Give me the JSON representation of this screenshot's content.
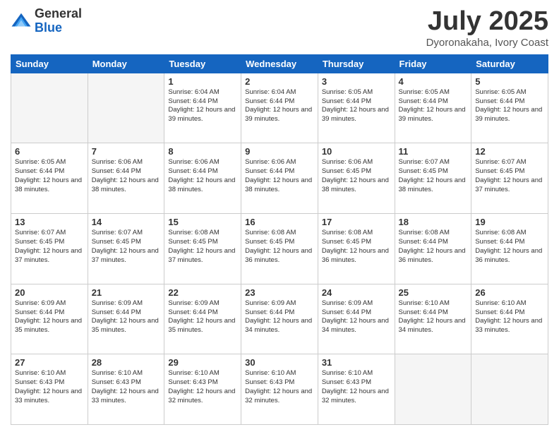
{
  "header": {
    "logo_general": "General",
    "logo_blue": "Blue",
    "title": "July 2025",
    "subtitle": "Dyoronakaha, Ivory Coast"
  },
  "calendar": {
    "days_of_week": [
      "Sunday",
      "Monday",
      "Tuesday",
      "Wednesday",
      "Thursday",
      "Friday",
      "Saturday"
    ],
    "weeks": [
      [
        {
          "day": "",
          "info": ""
        },
        {
          "day": "",
          "info": ""
        },
        {
          "day": "1",
          "info": "Sunrise: 6:04 AM\nSunset: 6:44 PM\nDaylight: 12 hours and 39 minutes."
        },
        {
          "day": "2",
          "info": "Sunrise: 6:04 AM\nSunset: 6:44 PM\nDaylight: 12 hours and 39 minutes."
        },
        {
          "day": "3",
          "info": "Sunrise: 6:05 AM\nSunset: 6:44 PM\nDaylight: 12 hours and 39 minutes."
        },
        {
          "day": "4",
          "info": "Sunrise: 6:05 AM\nSunset: 6:44 PM\nDaylight: 12 hours and 39 minutes."
        },
        {
          "day": "5",
          "info": "Sunrise: 6:05 AM\nSunset: 6:44 PM\nDaylight: 12 hours and 39 minutes."
        }
      ],
      [
        {
          "day": "6",
          "info": "Sunrise: 6:05 AM\nSunset: 6:44 PM\nDaylight: 12 hours and 38 minutes."
        },
        {
          "day": "7",
          "info": "Sunrise: 6:06 AM\nSunset: 6:44 PM\nDaylight: 12 hours and 38 minutes."
        },
        {
          "day": "8",
          "info": "Sunrise: 6:06 AM\nSunset: 6:44 PM\nDaylight: 12 hours and 38 minutes."
        },
        {
          "day": "9",
          "info": "Sunrise: 6:06 AM\nSunset: 6:44 PM\nDaylight: 12 hours and 38 minutes."
        },
        {
          "day": "10",
          "info": "Sunrise: 6:06 AM\nSunset: 6:45 PM\nDaylight: 12 hours and 38 minutes."
        },
        {
          "day": "11",
          "info": "Sunrise: 6:07 AM\nSunset: 6:45 PM\nDaylight: 12 hours and 38 minutes."
        },
        {
          "day": "12",
          "info": "Sunrise: 6:07 AM\nSunset: 6:45 PM\nDaylight: 12 hours and 37 minutes."
        }
      ],
      [
        {
          "day": "13",
          "info": "Sunrise: 6:07 AM\nSunset: 6:45 PM\nDaylight: 12 hours and 37 minutes."
        },
        {
          "day": "14",
          "info": "Sunrise: 6:07 AM\nSunset: 6:45 PM\nDaylight: 12 hours and 37 minutes."
        },
        {
          "day": "15",
          "info": "Sunrise: 6:08 AM\nSunset: 6:45 PM\nDaylight: 12 hours and 37 minutes."
        },
        {
          "day": "16",
          "info": "Sunrise: 6:08 AM\nSunset: 6:45 PM\nDaylight: 12 hours and 36 minutes."
        },
        {
          "day": "17",
          "info": "Sunrise: 6:08 AM\nSunset: 6:45 PM\nDaylight: 12 hours and 36 minutes."
        },
        {
          "day": "18",
          "info": "Sunrise: 6:08 AM\nSunset: 6:44 PM\nDaylight: 12 hours and 36 minutes."
        },
        {
          "day": "19",
          "info": "Sunrise: 6:08 AM\nSunset: 6:44 PM\nDaylight: 12 hours and 36 minutes."
        }
      ],
      [
        {
          "day": "20",
          "info": "Sunrise: 6:09 AM\nSunset: 6:44 PM\nDaylight: 12 hours and 35 minutes."
        },
        {
          "day": "21",
          "info": "Sunrise: 6:09 AM\nSunset: 6:44 PM\nDaylight: 12 hours and 35 minutes."
        },
        {
          "day": "22",
          "info": "Sunrise: 6:09 AM\nSunset: 6:44 PM\nDaylight: 12 hours and 35 minutes."
        },
        {
          "day": "23",
          "info": "Sunrise: 6:09 AM\nSunset: 6:44 PM\nDaylight: 12 hours and 34 minutes."
        },
        {
          "day": "24",
          "info": "Sunrise: 6:09 AM\nSunset: 6:44 PM\nDaylight: 12 hours and 34 minutes."
        },
        {
          "day": "25",
          "info": "Sunrise: 6:10 AM\nSunset: 6:44 PM\nDaylight: 12 hours and 34 minutes."
        },
        {
          "day": "26",
          "info": "Sunrise: 6:10 AM\nSunset: 6:44 PM\nDaylight: 12 hours and 33 minutes."
        }
      ],
      [
        {
          "day": "27",
          "info": "Sunrise: 6:10 AM\nSunset: 6:43 PM\nDaylight: 12 hours and 33 minutes."
        },
        {
          "day": "28",
          "info": "Sunrise: 6:10 AM\nSunset: 6:43 PM\nDaylight: 12 hours and 33 minutes."
        },
        {
          "day": "29",
          "info": "Sunrise: 6:10 AM\nSunset: 6:43 PM\nDaylight: 12 hours and 32 minutes."
        },
        {
          "day": "30",
          "info": "Sunrise: 6:10 AM\nSunset: 6:43 PM\nDaylight: 12 hours and 32 minutes."
        },
        {
          "day": "31",
          "info": "Sunrise: 6:10 AM\nSunset: 6:43 PM\nDaylight: 12 hours and 32 minutes."
        },
        {
          "day": "",
          "info": ""
        },
        {
          "day": "",
          "info": ""
        }
      ]
    ]
  }
}
